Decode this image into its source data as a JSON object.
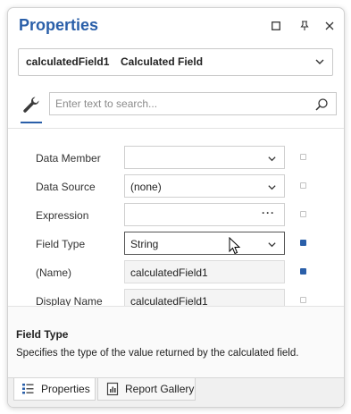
{
  "panel": {
    "title": "Properties",
    "buttons": {
      "restore": "restore-icon",
      "pin": "pin-icon",
      "close": "close-icon"
    }
  },
  "selector": {
    "name": "calculatedField1",
    "type": "Calculated Field"
  },
  "toolbar": {
    "tool_icon": "wrench-icon",
    "search_placeholder": "Enter text to search..."
  },
  "properties": [
    {
      "label": "Data Member",
      "value": "",
      "editor": "dropdown",
      "marker": false
    },
    {
      "label": "Data Source",
      "value": "(none)",
      "editor": "dropdown",
      "marker": false
    },
    {
      "label": "Expression",
      "value": "",
      "editor": "ellipsis",
      "button": "···",
      "marker": false
    },
    {
      "label": "Field Type",
      "value": "String",
      "editor": "dropdown",
      "marker": true
    },
    {
      "label": "(Name)",
      "value": "calculatedField1",
      "editor": "readonly",
      "marker": true
    },
    {
      "label": "Display Name",
      "value": "calculatedField1",
      "editor": "readonly",
      "marker": false
    }
  ],
  "description": {
    "heading": "Field Type",
    "text": "Specifies the type of the value returned by the calculated field."
  },
  "tabs": [
    {
      "label": "Properties",
      "icon": "properties-grid-icon",
      "active": true
    },
    {
      "label": "Report Gallery",
      "icon": "report-gallery-icon",
      "active": false
    }
  ],
  "colors": {
    "accent": "#2a5fa9",
    "marker_on": "#2a5fa9"
  }
}
